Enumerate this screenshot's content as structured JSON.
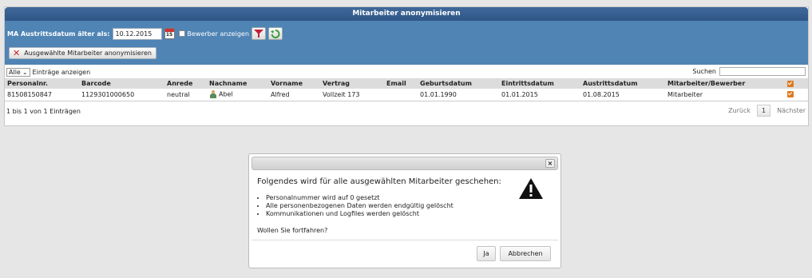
{
  "panel": {
    "title": "Mitarbeiter anonymisieren",
    "date_label": "MA Austrittsdatum älter als:",
    "date_value": "10.12.2015",
    "calendar_day": "15",
    "applicant_checkbox_label": "Bewerber anzeigen",
    "anonymize_button": "Ausgewählte Mitarbeiter anonymisieren"
  },
  "listing": {
    "length_value": "Alle",
    "length_suffix": "Einträge anzeigen",
    "search_label": "Suchen"
  },
  "table": {
    "headers": [
      "Personalnr.",
      "Barcode",
      "Anrede",
      "Nachname",
      "Vorname",
      "Vertrag",
      "Email",
      "Geburtsdatum",
      "Eintrittsdatum",
      "Austrittsdatum",
      "Mitarbeiter/Bewerber"
    ],
    "rows": [
      {
        "personalnr": "81508150847",
        "barcode": "1129301000650",
        "anrede": "neutral",
        "nachname": "Abel",
        "vorname": "Alfred",
        "vertrag": "Vollzeit 173",
        "email": "",
        "geburtsdatum": "01.01.1990",
        "eintrittsdatum": "01.01.2015",
        "austrittsdatum": "01.08.2015",
        "typ": "Mitarbeiter",
        "selected": true
      }
    ]
  },
  "footer": {
    "info": "1 bis 1 von 1 Einträgen",
    "prev": "Zurück",
    "page": "1",
    "next": "Nächster"
  },
  "dialog": {
    "close": "×",
    "heading": "Folgendes wird für alle ausgewählten Mitarbeiter geschehen:",
    "items": [
      "Personalnummer wird auf 0 gesetzt",
      "Alle personenbezogenen Daten werden endgültig gelöscht",
      "Kommunikationen und Logfiles werden gelöscht"
    ],
    "question": "Wollen Sie fortfahren?",
    "yes": "Ja",
    "cancel": "Abbrechen"
  },
  "colors": {
    "header_blue": "#2f5586",
    "toolbar_blue": "#4f84b5",
    "checkbox_orange": "#e07820"
  }
}
